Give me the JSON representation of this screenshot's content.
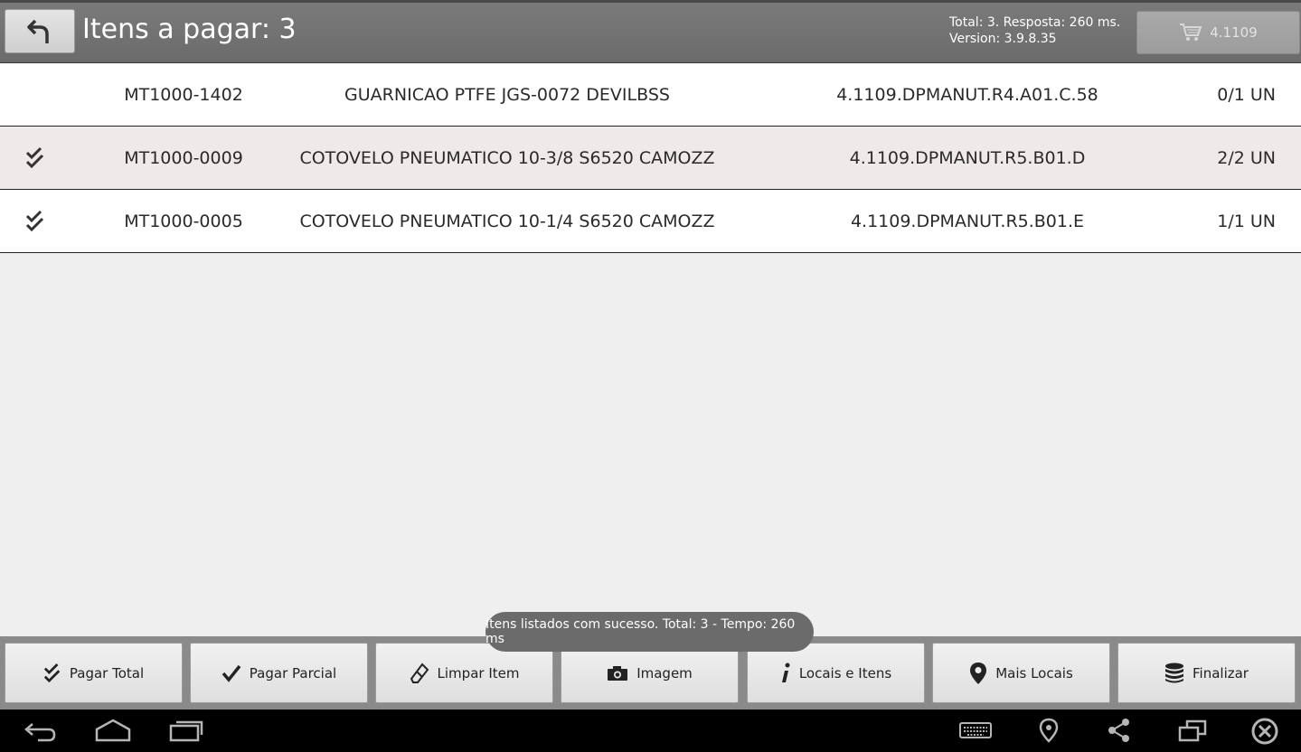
{
  "header": {
    "title": "Itens a pagar: 3",
    "info_line1": "Total: 3. Resposta: 260 ms.",
    "info_line2": "Version: 3.9.8.35",
    "cart_label": "4.1109"
  },
  "table": {
    "rows": [
      {
        "checked": false,
        "code": "MT1000-1402",
        "description": "GUARNICAO PTFE JGS-0072 DEVILBSS",
        "location": "4.1109.DPMANUT.R4.A01.C.58",
        "quantity": "0/1 UN"
      },
      {
        "checked": true,
        "code": "MT1000-0009",
        "description": "COTOVELO PNEUMATICO 10-3/8 S6520 CAMOZZ",
        "location": "4.1109.DPMANUT.R5.B01.D",
        "quantity": "2/2 UN"
      },
      {
        "checked": true,
        "code": "MT1000-0005",
        "description": "COTOVELO PNEUMATICO 10-1/4 S6520 CAMOZZ",
        "location": "4.1109.DPMANUT.R5.B01.E",
        "quantity": "1/1 UN"
      }
    ]
  },
  "toast": {
    "message": "Itens listados com sucesso. Total: 3 - Tempo: 260 ms"
  },
  "actions": {
    "pagar_total": "Pagar Total",
    "pagar_parcial": "Pagar Parcial",
    "limpar_item": "Limpar Item",
    "imagem": "Imagem",
    "locais_itens": "Locais e Itens",
    "mais_locais": "Mais Locais",
    "finalizar": "Finalizar"
  },
  "icons": {
    "back": "undo-arrow-icon",
    "cart": "shopping-cart-icon",
    "double_check": "double-check-icon",
    "check": "check-icon",
    "eraser": "eraser-icon",
    "camera": "camera-icon",
    "info": "info-icon",
    "pin": "map-pin-icon",
    "database": "database-icon"
  },
  "colors": {
    "header_bg": "#6b6b6b",
    "row_alt_bg": "#efe9e9",
    "toast_bg": "#6b6b6b",
    "navbar_bg": "#000000"
  }
}
